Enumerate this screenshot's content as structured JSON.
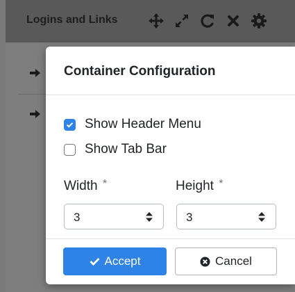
{
  "widget": {
    "title": "Logins and Links",
    "header_icons": [
      "move-icon",
      "expand-icon",
      "refresh-icon",
      "close-icon",
      "gear-icon"
    ],
    "row_icons": [
      "sign-in-icon",
      "sign-in-icon"
    ]
  },
  "modal": {
    "title": "Container Configuration",
    "options": [
      {
        "label": "Show Header Menu",
        "checked": true
      },
      {
        "label": "Show Tab Bar",
        "checked": false
      }
    ],
    "width": {
      "label": "Width",
      "required_mark": "*",
      "value": "3"
    },
    "height": {
      "label": "Height",
      "required_mark": "*",
      "value": "3"
    },
    "accept_label": "Accept",
    "cancel_label": "Cancel"
  },
  "colors": {
    "accent": "#2f83e6",
    "overlay_header": "#595959",
    "overlay_body": "#7e7e7e"
  }
}
